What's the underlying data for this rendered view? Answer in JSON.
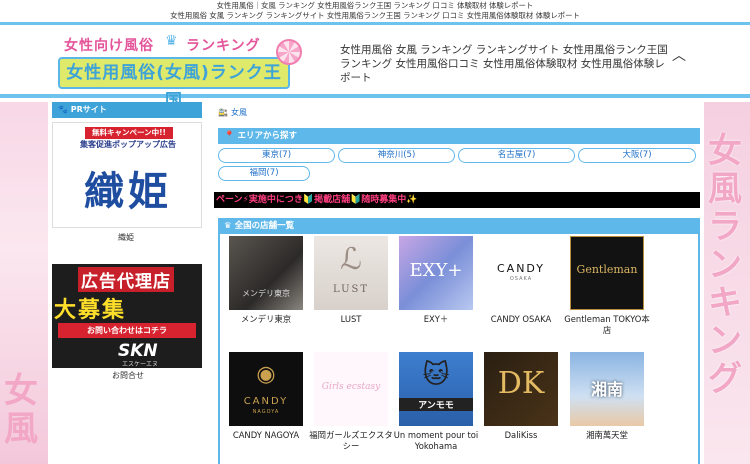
{
  "topbar": {
    "line1": "女性用風俗｜女風 ランキング 女性用風俗ランク王国 ランキング 口コミ 体験取材 体験レポート",
    "line2": "女性用風俗 女風 ランキング ランキングサイト 女性用風俗ランク王国 ランキング 口コミ 女性用風俗体験取材 体験レポート"
  },
  "header": {
    "logo_line1a": "女性向け風俗",
    "logo_line1b": "ランキング",
    "logo_line2": "女性用風俗(女風)ランク王国",
    "text": "女性用風俗 女風 ランキング ランキングサイト 女性用風俗ランク王国 ランキング 女性用風俗口コミ 女性用風俗体験取材 女性用風俗体験レポート",
    "toggle_icon": "chevron-up-icon"
  },
  "background": {
    "right_text": "女風ランキング",
    "left_text": "女風"
  },
  "sidebar": {
    "title": "PRサイト",
    "ad1": {
      "badge": "無料キャンペーン中!!",
      "sub": "集客促進ポップアップ広告",
      "big": "織姫",
      "caption": "織姫"
    },
    "ad2": {
      "line1": "広告代理店",
      "line2": "大募集",
      "line3": "お問い合わせはコチラ",
      "brand": "SKN",
      "brand_sub": "エスケーエヌ",
      "caption": "お問合せ"
    }
  },
  "main": {
    "breadcrumb": "女風",
    "area_title": "エリアから探す",
    "areas": [
      "東京(7)",
      "神奈川(5)",
      "名古屋(7)",
      "大阪(7)",
      "福岡(7)"
    ],
    "marquee": "ペーン⚡実施中につき🔰掲載店舗🔰随時募集中✨",
    "shops_title": "全国の店舗一覧",
    "shops": [
      {
        "name": "メンデリ東京",
        "img_text": "メンデリ東京"
      },
      {
        "name": "LUST",
        "img_text": "LUST"
      },
      {
        "name": "EXY＋",
        "img_text": "EXY+"
      },
      {
        "name": "CANDY OSAKA",
        "img_text": "CANDY",
        "img_sub": "OSAKA"
      },
      {
        "name": "Gentleman TOKYO本店",
        "img_text": "Gentleman"
      },
      {
        "name": "CANDY NAGOYA",
        "img_text": "CANDY",
        "img_sub": "NAGOYA"
      },
      {
        "name": "福岡ガールズエクスタシー",
        "img_text": "Girls ecstasy"
      },
      {
        "name": "Un moment pour toi Yokohama",
        "img_text": "アンモモ"
      },
      {
        "name": "DaliKiss",
        "img_text": "DK"
      },
      {
        "name": "湘南萬天堂",
        "img_text": "湘南"
      }
    ]
  },
  "colors": {
    "accent": "#5fb8ea",
    "pink": "#e4559a",
    "marquee_text": "#ff3d7f"
  }
}
